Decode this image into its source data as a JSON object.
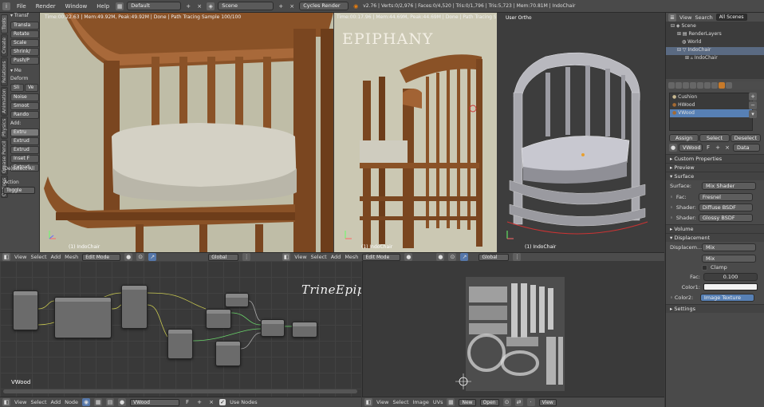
{
  "topbar": {
    "menus": [
      "File",
      "Render",
      "Window",
      "Help"
    ],
    "layout": "Default",
    "scene": "Scene",
    "engine": "Cycles Render",
    "stats": "v2.76 | Verts:0/2,976 | Faces:0/4,520 | Tris:0/1,796 | Tris:5,723 | Mem:70.81M | IndoChair"
  },
  "toolshelf": {
    "tab_labels": [
      "Tools",
      "Create",
      "Relations",
      "Animation",
      "Physics",
      "Grease Pencil",
      "Options"
    ],
    "transform_header": "Transf",
    "transform_btns": [
      "Transla",
      "Rotate",
      "Scale",
      "Shrink/",
      "Push/P"
    ],
    "mesh_header": "Me",
    "deform_label": "Deform",
    "deform_btns_row": [
      "Sli",
      "Ve"
    ],
    "deform_btns": [
      "Noise",
      "Smoot",
      "Rando"
    ],
    "add_label": "Add:",
    "add_btns": [
      "Extru",
      "Extrud",
      "Extrud",
      "Inset F",
      "Extrud"
    ],
    "last_op_header": "(De)select All",
    "action_label": "Action",
    "action_value": "Toggle"
  },
  "viewport1": {
    "stat": "Time:00:22.63 | Mem:49.92M, Peak:49.92M | Done | Path Tracing Sample 100/100",
    "label": "(1) IndoChair"
  },
  "viewport2": {
    "stat": "Time:00:17.96 | Mem:44.69M, Peak:44.69M | Done | Path Tracing Sample 100/100",
    "watermark": "EPIPHANY",
    "label": "(1) IndoChair"
  },
  "viewport3": {
    "title": "User Ortho",
    "label": "(1) IndoChair"
  },
  "view_header": {
    "items": [
      "View",
      "Select",
      "Add",
      "Mesh"
    ],
    "mode": "Edit Mode",
    "pivot": "Global"
  },
  "node_editor": {
    "watermark": "TrineEpiphany.com",
    "material_label": "VWood",
    "header_items": [
      "View",
      "Select",
      "Add",
      "Node"
    ],
    "material": "VWood",
    "use_nodes": "Use Nodes"
  },
  "uv_editor": {
    "header_items": [
      "View",
      "Select",
      "Image",
      "UVs"
    ],
    "new": "New",
    "open": "Open",
    "view": "View"
  },
  "outliner": {
    "header": [
      "View",
      "Search",
      "All Scenes"
    ],
    "items": [
      "Scene",
      "RenderLayers",
      "World",
      "IndoChair",
      "IndoChair"
    ]
  },
  "properties": {
    "materials": [
      "Cushion",
      "HWood",
      "VWood"
    ],
    "buttons": [
      "Assign",
      "Select",
      "Deselect"
    ],
    "material_name": "VWood",
    "data_select": "Data",
    "sections": {
      "custom": "Custom Properties",
      "preview": "Preview",
      "surface": "Surface",
      "volume": "Volume",
      "displacement": "Displacement",
      "settings": "Settings"
    },
    "surface": {
      "label": "Surface:",
      "value": "Mix Shader"
    },
    "fac": {
      "label": "Fac:",
      "value": "Fresnel"
    },
    "shader1": {
      "label": "Shader:",
      "value": "Diffuse BSDF"
    },
    "shader2": {
      "label": "Shader:",
      "value": "Glossy BSDF"
    },
    "displacement": {
      "label": "Displacem...",
      "value": "Mix"
    },
    "mix": "Mix",
    "clamp": "Clamp",
    "fac2": {
      "label": "Fac:",
      "value": "0.100"
    },
    "color1": "Color1:",
    "color2": {
      "label": "Color2:",
      "value": "Image Texture"
    }
  }
}
